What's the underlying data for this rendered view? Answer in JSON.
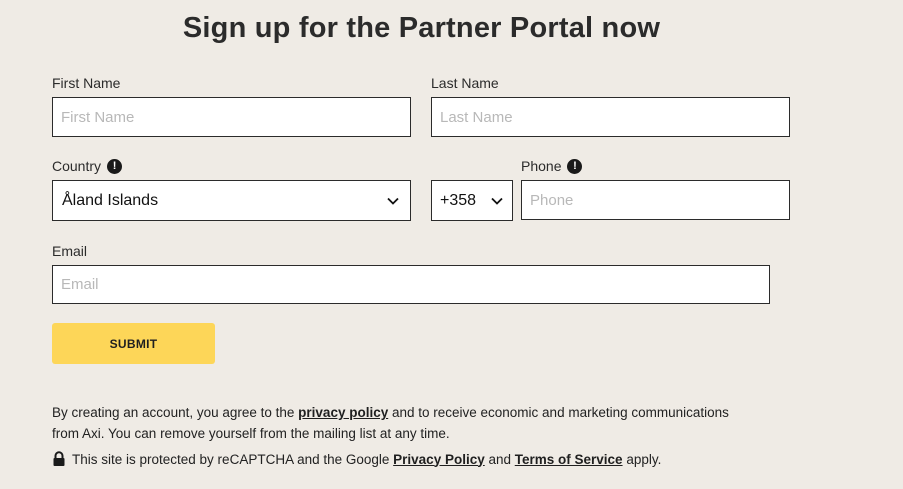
{
  "form": {
    "title": "Sign up for the Partner Portal now",
    "first_name": {
      "label": "First Name",
      "placeholder": "First Name",
      "value": ""
    },
    "last_name": {
      "label": "Last Name",
      "placeholder": "Last Name",
      "value": ""
    },
    "country": {
      "label": "Country",
      "selected": "Åland Islands",
      "info_icon": "exclamation-circle-icon"
    },
    "phone_code": {
      "selected": "+358"
    },
    "phone": {
      "label": "Phone",
      "placeholder": "Phone",
      "value": "",
      "info_icon": "exclamation-circle-icon"
    },
    "email": {
      "label": "Email",
      "placeholder": "Email",
      "value": ""
    },
    "submit_label": "SUBMIT"
  },
  "legal": {
    "text_1": "By creating an account, you agree to the ",
    "privacy_link": "privacy policy",
    "text_2": " and to receive economic and marketing communications from Axi. You can remove yourself from the mailing list at any time."
  },
  "recaptcha": {
    "text_1": "This site is protected by reCAPTCHA and the Google ",
    "privacy_link": "Privacy Policy",
    "text_2": " and ",
    "terms_link": "Terms of Service",
    "text_3": " apply.",
    "icon": "lock-icon"
  },
  "colors": {
    "background": "#efebe5",
    "submit_button": "#fdd658",
    "border": "#2b2b2b"
  }
}
